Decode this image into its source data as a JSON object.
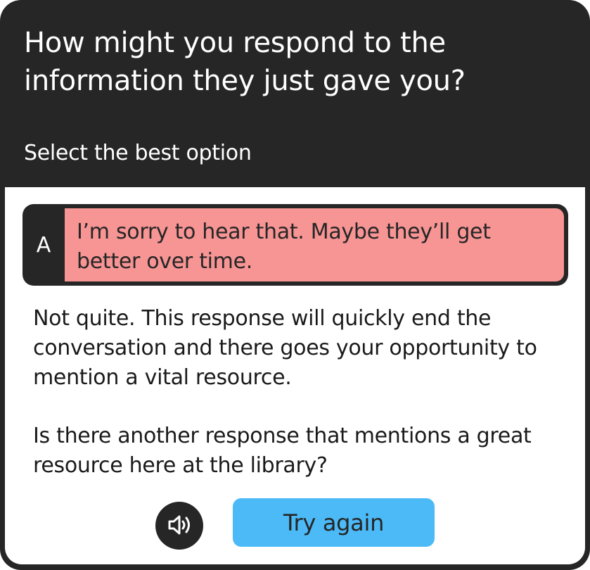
{
  "header": {
    "question": "How might you respond to the information they just gave you?",
    "instruction": "Select the best option"
  },
  "option": {
    "letter": "A",
    "text": "I’m sorry to hear that. Maybe they’ll get better over time.",
    "state": "incorrect",
    "highlight_color": "#f79494"
  },
  "feedback": {
    "message": "Not quite. This response will quickly end the conversation and there goes your opportunity to mention a vital resource.",
    "hint": "Is there another response that mentions a great resource here at the library?"
  },
  "actions": {
    "audio_icon": "speaker-icon",
    "try_again_label": "Try again",
    "try_again_color": "#4bbaf7"
  },
  "colors": {
    "dark": "#262626",
    "surface": "#ffffff"
  }
}
